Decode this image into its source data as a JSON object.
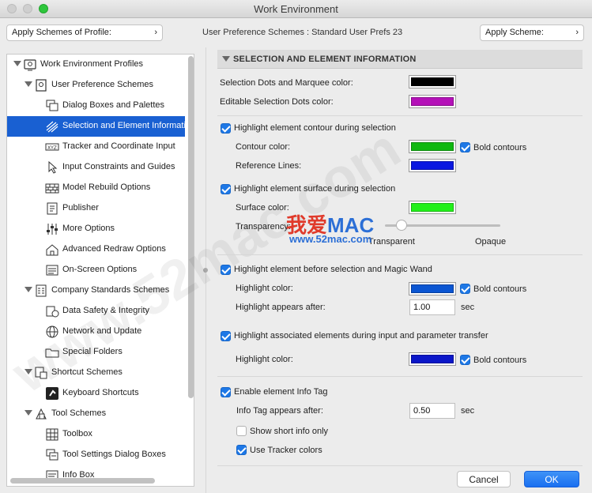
{
  "window": {
    "title": "Work Environment"
  },
  "topbar": {
    "apply_profile_label": "Apply Schemes of Profile:",
    "scheme_info": "User Preference Schemes : Standard User Prefs 23",
    "apply_scheme_label": "Apply Scheme:"
  },
  "tree": {
    "items": [
      {
        "label": "Work Environment Profiles",
        "icon": "profiles-icon"
      },
      {
        "label": "User Preference Schemes",
        "icon": "user-prefs-icon"
      },
      {
        "label": "Dialog Boxes and Palettes",
        "icon": "dialog-boxes-icon"
      },
      {
        "label": "Selection and Element Information",
        "icon": "selection-icon"
      },
      {
        "label": "Tracker and Coordinate Input",
        "icon": "xyz-icon"
      },
      {
        "label": "Input Constraints and Guides",
        "icon": "cursor-icon"
      },
      {
        "label": "Model Rebuild Options",
        "icon": "bricks-icon"
      },
      {
        "label": "Publisher",
        "icon": "publisher-icon"
      },
      {
        "label": "More Options",
        "icon": "sliders-icon"
      },
      {
        "label": "Advanced Redraw Options",
        "icon": "house-icon"
      },
      {
        "label": "On-Screen Options",
        "icon": "list-icon"
      },
      {
        "label": "Company Standards Schemes",
        "icon": "company-icon"
      },
      {
        "label": "Data Safety & Integrity",
        "icon": "data-safety-icon"
      },
      {
        "label": "Network and Update",
        "icon": "globe-icon"
      },
      {
        "label": "Special Folders",
        "icon": "folder-icon"
      },
      {
        "label": "Shortcut Schemes",
        "icon": "shortcut-icon"
      },
      {
        "label": "Keyboard Shortcuts",
        "icon": "keyboard-icon"
      },
      {
        "label": "Tool Schemes",
        "icon": "tool-schemes-icon"
      },
      {
        "label": "Toolbox",
        "icon": "toolbox-icon"
      },
      {
        "label": "Tool Settings Dialog Boxes",
        "icon": "tool-settings-icon"
      },
      {
        "label": "Info Box",
        "icon": "info-box-icon"
      }
    ]
  },
  "panel": {
    "section_title": "SELECTION AND ELEMENT INFORMATION",
    "sel_dots_label": "Selection Dots and Marquee color:",
    "edit_dots_label": "Editable Selection Dots color:",
    "hl_contour_label": "Highlight element contour during selection",
    "contour_color_label": "Contour color:",
    "bold_contours_label": "Bold contours",
    "reference_lines_label": "Reference Lines:",
    "hl_surface_label": "Highlight element surface during selection",
    "surface_color_label": "Surface color:",
    "transparency_label": "Transparency:",
    "transparent_label": "Transparent",
    "opaque_label": "Opaque",
    "hl_before_label": "Highlight element before selection and Magic Wand",
    "highlight_color_label": "Highlight color:",
    "appears_after_label": "Highlight appears after:",
    "appears_after_value": "1.00",
    "sec_label": "sec",
    "hl_associated_label": "Highlight associated elements during input and parameter transfer",
    "info_tag_label": "Enable element Info Tag",
    "info_tag_after_label": "Info Tag appears after:",
    "info_tag_after_value": "0.50",
    "short_info_label": "Show short info only",
    "tracker_colors_label": "Use Tracker colors"
  },
  "colors": {
    "sel_dots": "#000000",
    "edit_dots": "#b411b8",
    "contour": "#10b810",
    "reference": "#0a17e0",
    "surface": "#22f01a",
    "highlight_before": "#0a55d2",
    "highlight_assoc": "#0a16c8",
    "accent": "#1960d2"
  },
  "transparency_level": 0.1,
  "watermark": {
    "big_a": "我爱",
    "big_b": "MAC",
    "small": "www.52mac.com",
    "diag": "www.52mac.com"
  },
  "buttons": {
    "cancel": "Cancel",
    "ok": "OK"
  }
}
